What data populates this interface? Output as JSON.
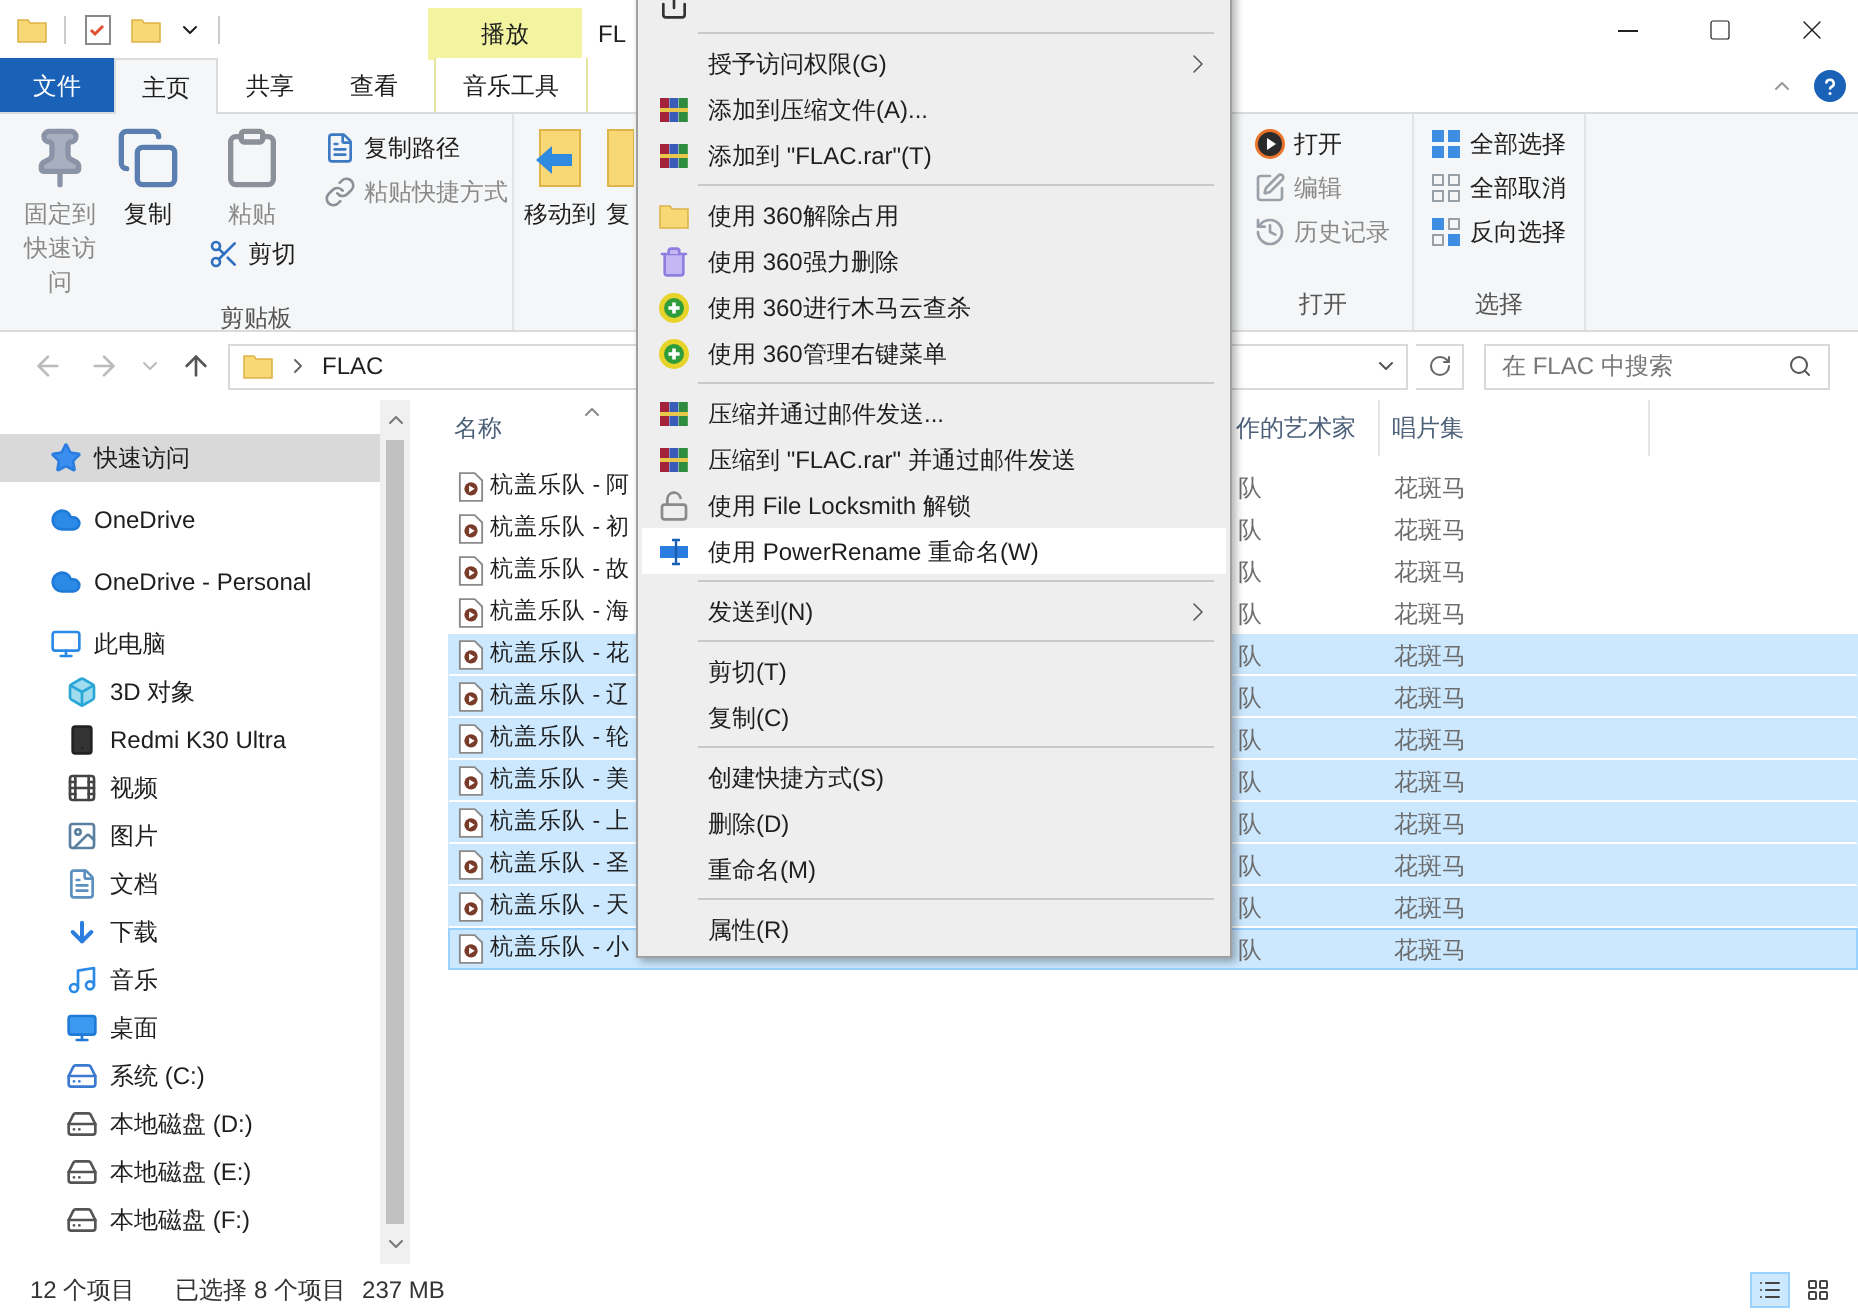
{
  "title_bar": {
    "contextual_group": "播放",
    "title": "FL"
  },
  "ribbon_tabs": [
    {
      "label": "文件",
      "kind": "file",
      "selected": false
    },
    {
      "label": "主页",
      "kind": "tab",
      "selected": true
    },
    {
      "label": "共享",
      "kind": "tab",
      "selected": false
    },
    {
      "label": "查看",
      "kind": "tab",
      "selected": false
    },
    {
      "label": "音乐工具",
      "kind": "contextual",
      "selected": false
    }
  ],
  "ribbon": {
    "groups": [
      {
        "label": "剪贴板",
        "items": [
          {
            "label": "固定到快速访问",
            "kind": "pin",
            "disabled": true
          },
          {
            "label": "复制",
            "kind": "copy",
            "disabled": false
          },
          {
            "label": "粘贴",
            "kind": "paste",
            "disabled": true
          },
          {
            "label": "剪切",
            "kind": "cut",
            "disabled": false
          },
          {
            "label": "复制路径",
            "kind": "copy_path",
            "disabled": false
          },
          {
            "label": "粘贴快捷方式",
            "kind": "paste_shortcut",
            "disabled": true
          }
        ]
      },
      {
        "items": [
          {
            "label": "移动到",
            "kind": "move_to",
            "disabled": false
          },
          {
            "label": "复",
            "kind": "copy_to",
            "disabled": false
          }
        ]
      },
      {
        "label": "打开",
        "items": [
          {
            "label": "打开",
            "kind": "open",
            "disabled": false
          },
          {
            "label": "编辑",
            "kind": "edit",
            "disabled": true
          },
          {
            "label": "历史记录",
            "kind": "history",
            "disabled": true
          }
        ]
      },
      {
        "label": "选择",
        "items": [
          {
            "label": "全部选择",
            "kind": "select_all",
            "disabled": false
          },
          {
            "label": "全部取消",
            "kind": "select_none",
            "disabled": false
          },
          {
            "label": "反向选择",
            "kind": "invert",
            "disabled": false
          }
        ]
      }
    ]
  },
  "address_bar": {
    "path": "FLAC",
    "search_placeholder": "在 FLAC 中搜索"
  },
  "navigation": [
    {
      "label": "快速访问",
      "kind": "quick",
      "selected": true
    },
    {
      "label": "OneDrive",
      "kind": "cloud",
      "selected": false
    },
    {
      "label": "OneDrive - Personal",
      "kind": "cloud",
      "selected": false
    },
    {
      "label": "此电脑",
      "kind": "pc",
      "selected": false,
      "children": [
        {
          "label": "3D 对象",
          "kind": "objects",
          "selected": false
        },
        {
          "label": "Redmi K30 Ultra",
          "kind": "phone",
          "selected": false
        },
        {
          "label": "视频",
          "kind": "video",
          "selected": false
        },
        {
          "label": "图片",
          "kind": "pictures",
          "selected": false
        },
        {
          "label": "文档",
          "kind": "documents",
          "selected": false
        },
        {
          "label": "下载",
          "kind": "downloads",
          "selected": false
        },
        {
          "label": "音乐",
          "kind": "music",
          "selected": false
        },
        {
          "label": "桌面",
          "kind": "desktop",
          "selected": false
        },
        {
          "label": "系统 (C:)",
          "kind": "system_drive",
          "selected": false
        },
        {
          "label": "本地磁盘 (D:)",
          "kind": "drive",
          "selected": false
        },
        {
          "label": "本地磁盘 (E:)",
          "kind": "drive",
          "selected": false
        },
        {
          "label": "本地磁盘 (F:)",
          "kind": "drive",
          "selected": false
        }
      ]
    }
  ],
  "files": {
    "columns": [
      {
        "label": "名称",
        "sorted": true
      },
      {
        "label": "作的艺术家",
        "sorted": false
      },
      {
        "label": "唱片集",
        "sorted": false
      }
    ],
    "rows": [
      {
        "name": "杭盖乐队 - 阿",
        "artist": "队",
        "album": "花斑马",
        "selected": false,
        "focused": false
      },
      {
        "name": "杭盖乐队 - 初",
        "artist": "队",
        "album": "花斑马",
        "selected": false,
        "focused": false
      },
      {
        "name": "杭盖乐队 - 故",
        "artist": "队",
        "album": "花斑马",
        "selected": false,
        "focused": false
      },
      {
        "name": "杭盖乐队 - 海",
        "artist": "队",
        "album": "花斑马",
        "selected": false,
        "focused": false
      },
      {
        "name": "杭盖乐队 - 花",
        "artist": "队",
        "album": "花斑马",
        "selected": true,
        "focused": false
      },
      {
        "name": "杭盖乐队 - 辽",
        "artist": "队",
        "album": "花斑马",
        "selected": true,
        "focused": false
      },
      {
        "name": "杭盖乐队 - 轮",
        "artist": "队",
        "album": "花斑马",
        "selected": true,
        "focused": false
      },
      {
        "name": "杭盖乐队 - 美",
        "artist": "队",
        "album": "花斑马",
        "selected": true,
        "focused": false
      },
      {
        "name": "杭盖乐队 - 上",
        "artist": "队",
        "album": "花斑马",
        "selected": true,
        "focused": false
      },
      {
        "name": "杭盖乐队 - 圣",
        "artist": "队",
        "album": "花斑马",
        "selected": true,
        "focused": false
      },
      {
        "name": "杭盖乐队 - 天",
        "artist": "队",
        "album": "花斑马",
        "selected": true,
        "focused": false
      },
      {
        "name": "杭盖乐队 - 小",
        "artist": "队",
        "album": "花斑马",
        "selected": true,
        "focused": true
      }
    ]
  },
  "context_menu": {
    "groups": [
      [
        {
          "kind": "share",
          "submenu": false,
          "selected": false
        }
      ],
      [
        {
          "label": "授予访问权限(G)",
          "kind": "plain",
          "submenu": true,
          "selected": false
        },
        {
          "label": "添加到压缩文件(A)...",
          "kind": "archive",
          "submenu": false,
          "selected": false
        },
        {
          "label": "添加到 \"FLAC.rar\"(T)",
          "kind": "archive",
          "submenu": false,
          "selected": false
        }
      ],
      [
        {
          "label": "使用 360解除占用",
          "kind": "unlock_folder",
          "submenu": false,
          "selected": false
        },
        {
          "label": "使用 360强力删除",
          "kind": "shredder",
          "submenu": false,
          "selected": false
        },
        {
          "label": "使用 360进行木马云查杀",
          "kind": "guard",
          "submenu": false,
          "selected": false
        },
        {
          "label": "使用 360管理右键菜单",
          "kind": "guard",
          "submenu": false,
          "selected": false
        }
      ],
      [
        {
          "label": "压缩并通过邮件发送...",
          "kind": "archive",
          "submenu": false,
          "selected": false
        },
        {
          "label": "压缩到 \"FLAC.rar\" 并通过邮件发送",
          "kind": "archive",
          "submenu": false,
          "selected": false
        },
        {
          "label": "使用 File Locksmith 解锁",
          "kind": "lock",
          "submenu": false,
          "selected": false
        },
        {
          "label": "使用 PowerRename 重命名(W)",
          "kind": "rename",
          "submenu": false,
          "selected": true
        }
      ],
      [
        {
          "label": "发送到(N)",
          "kind": "plain",
          "submenu": true,
          "selected": false
        }
      ],
      [
        {
          "label": "剪切(T)",
          "kind": "plain",
          "submenu": false,
          "selected": false
        },
        {
          "label": "复制(C)",
          "kind": "plain",
          "submenu": false,
          "selected": false
        }
      ],
      [
        {
          "label": "创建快捷方式(S)",
          "kind": "plain",
          "submenu": false,
          "selected": false
        },
        {
          "label": "删除(D)",
          "kind": "plain",
          "submenu": false,
          "selected": false
        },
        {
          "label": "重命名(M)",
          "kind": "plain",
          "submenu": false,
          "selected": false
        }
      ],
      [
        {
          "label": "属性(R)",
          "kind": "plain",
          "submenu": false,
          "selected": false
        }
      ]
    ]
  },
  "status_bar": {
    "item_count": "12 个项目",
    "selection": "已选择 8 个项目",
    "size": "237 MB",
    "view_buttons": [
      {
        "kind": "details",
        "selected": true
      },
      {
        "kind": "large_icons",
        "selected": false
      }
    ]
  }
}
